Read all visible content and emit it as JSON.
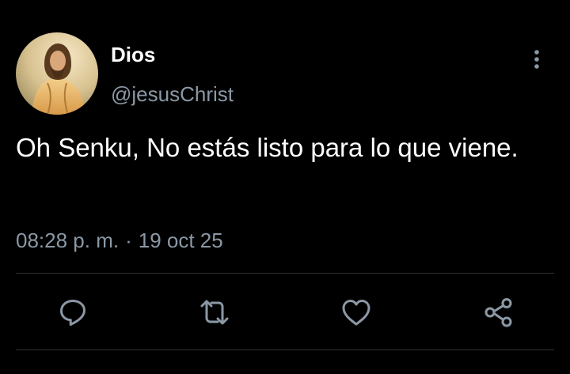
{
  "user": {
    "display_name": "Dios",
    "handle": "@jesusChrist",
    "avatar_icon": "profile-photo"
  },
  "tweet": {
    "text": "Oh Senku, No estás listo para lo que viene.",
    "time": "08:28 p. m.",
    "separator": "·",
    "date": "19 oct 25"
  },
  "actions": {
    "reply_icon": "reply-icon",
    "retweet_icon": "retweet-icon",
    "like_icon": "heart-icon",
    "share_icon": "share-icon",
    "more_icon": "more-vertical-icon"
  },
  "colors": {
    "background": "#000000",
    "text": "#ffffff",
    "secondary_text": "#8b98a5",
    "divider": "#2f3336"
  }
}
